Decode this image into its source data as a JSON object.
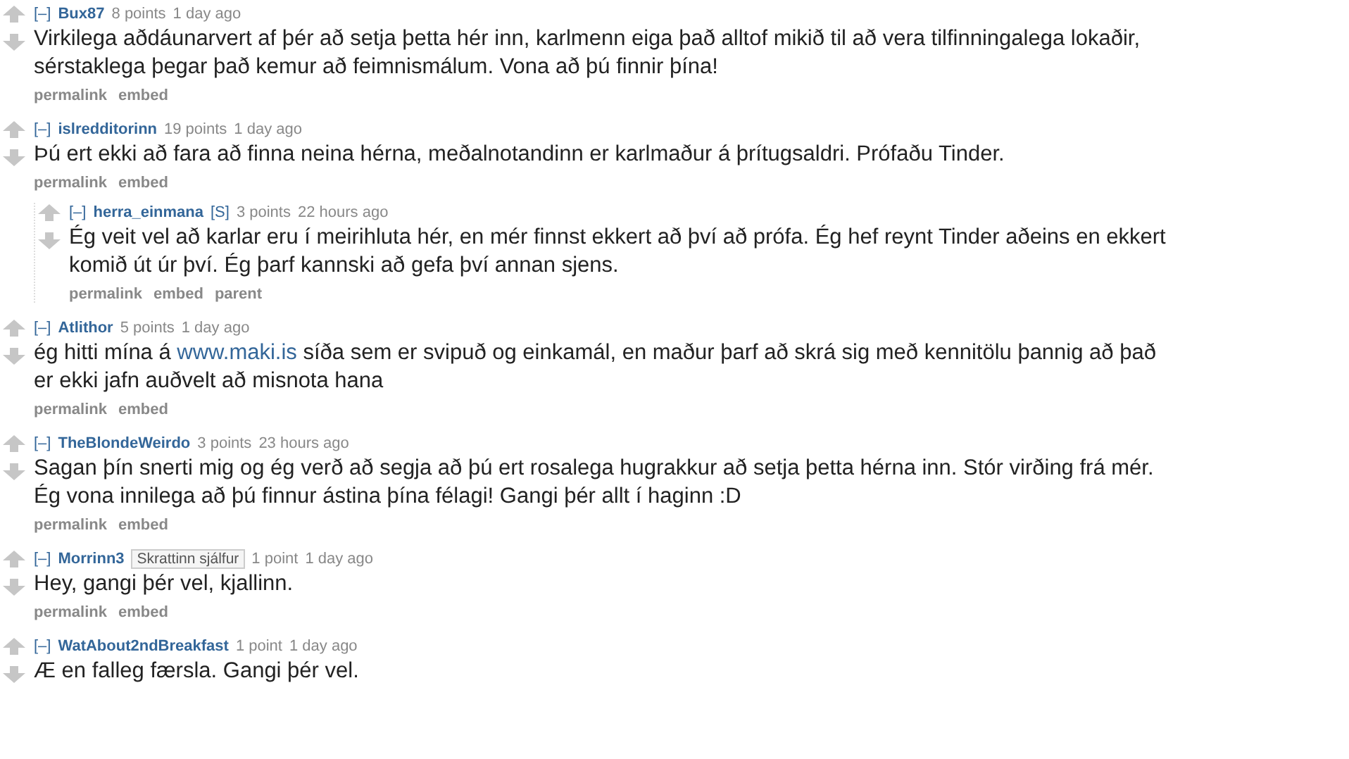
{
  "comments": [
    {
      "collapse": "[–]",
      "author": "Bux87",
      "score": "8 points",
      "time": "1 day ago",
      "body": [
        {
          "kind": "text",
          "text": "Virkilega aðdáunarvert af þér að setja þetta hér inn, karlmenn eiga það alltof mikið til að vera tilfinningalega lokaðir,\nsérstaklega þegar það kemur að feimnismálum. Vona að þú finnir þína!"
        }
      ],
      "actions": [
        "permalink",
        "embed"
      ]
    },
    {
      "collapse": "[–]",
      "author": "islredditorinn",
      "score": "19 points",
      "time": "1 day ago",
      "body": [
        {
          "kind": "text",
          "text": "Þú ert ekki að fara að finna neina hérna, meðalnotandinn er karlmaður á þrítugsaldri. Prófaðu Tinder."
        }
      ],
      "actions": [
        "permalink",
        "embed"
      ],
      "children": [
        {
          "collapse": "[–]",
          "author": "herra_einmana",
          "submitter": "[S]",
          "score": "3 points",
          "time": "22 hours ago",
          "body": [
            {
              "kind": "text",
              "text": "Ég veit vel að karlar eru í meirihluta hér, en mér finnst ekkert að því að prófa. Ég hef reynt Tinder aðeins en ekkert\nkomið út úr því. Ég þarf kannski að gefa því annan sjens."
            }
          ],
          "actions": [
            "permalink",
            "embed",
            "parent"
          ]
        }
      ]
    },
    {
      "collapse": "[–]",
      "author": "Atlithor",
      "score": "5 points",
      "time": "1 day ago",
      "body": [
        {
          "kind": "text",
          "text": "ég hitti mína á "
        },
        {
          "kind": "link",
          "text": "www.maki.is"
        },
        {
          "kind": "text",
          "text": " síða sem er svipuð og einkamál, en maður þarf að skrá sig með kennitölu þannig að það\ner ekki jafn auðvelt að misnota hana"
        }
      ],
      "actions": [
        "permalink",
        "embed"
      ]
    },
    {
      "collapse": "[–]",
      "author": "TheBlondeWeirdo",
      "score": "3 points",
      "time": "23 hours ago",
      "body": [
        {
          "kind": "text",
          "text": "Sagan þín snerti mig og ég verð að segja að þú ert rosalega hugrakkur að setja þetta hérna inn. Stór virðing frá mér.\nÉg vona innilega að þú finnur ástina þína félagi! Gangi þér allt í haginn :D"
        }
      ],
      "actions": [
        "permalink",
        "embed"
      ]
    },
    {
      "collapse": "[–]",
      "author": "Morrinn3",
      "flair": "Skrattinn sjálfur",
      "score": "1 point",
      "time": "1 day ago",
      "body": [
        {
          "kind": "text",
          "text": "Hey, gangi þér vel, kjallinn."
        }
      ],
      "actions": [
        "permalink",
        "embed"
      ]
    },
    {
      "collapse": "[–]",
      "author": "WatAbout2ndBreakfast",
      "score": "1 point",
      "time": "1 day ago",
      "body": [
        {
          "kind": "text",
          "text": "Æ en falleg færsla. Gangi þér vel."
        }
      ]
    }
  ]
}
